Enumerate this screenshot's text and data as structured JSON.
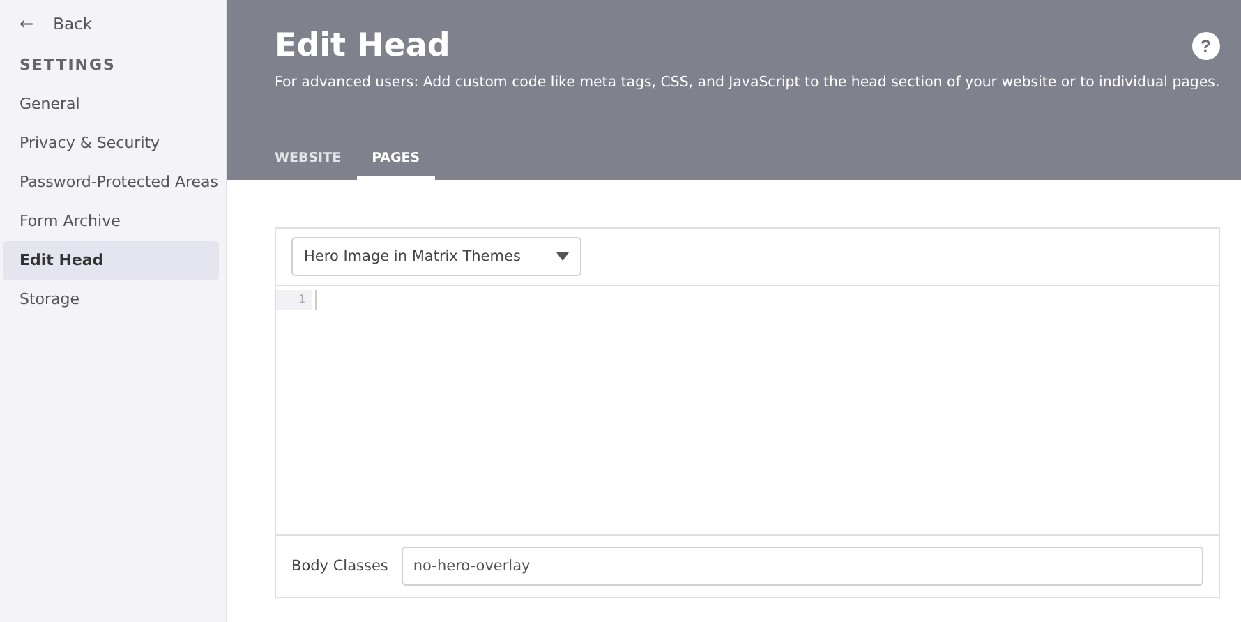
{
  "sidebar": {
    "back": {
      "icon": "←",
      "label": "Back"
    },
    "heading": "SETTINGS",
    "items": [
      {
        "label": "General",
        "selected": false
      },
      {
        "label": "Privacy & Security",
        "selected": false
      },
      {
        "label": "Password-Protected Areas",
        "selected": false
      },
      {
        "label": "Form Archive",
        "selected": false
      },
      {
        "label": "Edit Head",
        "selected": true
      },
      {
        "label": "Storage",
        "selected": false
      }
    ]
  },
  "header": {
    "title": "Edit Head",
    "help": "?",
    "description": "For advanced users: Add custom code like meta tags, CSS, and JavaScript to the head section of your website or to individual pages.",
    "tabs": [
      {
        "label": "WEBSITE",
        "selected": false
      },
      {
        "label": "PAGES",
        "selected": true
      }
    ]
  },
  "editor": {
    "page_select": {
      "value": "Hero Image in Matrix Themes"
    },
    "line_numbers": [
      "1"
    ],
    "body_classes": {
      "label": "Body Classes",
      "value": "no-hero-overlay"
    }
  }
}
